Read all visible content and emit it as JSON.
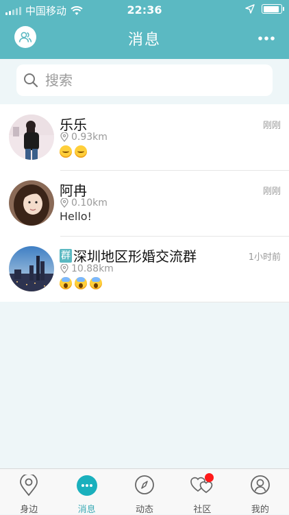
{
  "status_bar": {
    "carrier": "中国移动",
    "time": "22:36",
    "battery_level": 0.9
  },
  "header": {
    "title": "消息"
  },
  "search": {
    "placeholder": "搜索"
  },
  "conversations": [
    {
      "name": "乐乐",
      "is_group": false,
      "distance": "0.93km",
      "time": "刚刚",
      "message": "",
      "emojis": [
        "smile",
        "smile"
      ]
    },
    {
      "name": "阿冉",
      "is_group": false,
      "distance": "0.10km",
      "time": "刚刚",
      "message": "Hello!",
      "emojis": []
    },
    {
      "name": "深圳地区形婚交流群",
      "is_group": true,
      "group_badge": "群",
      "distance": "10.88km",
      "time": "1小时前",
      "message": "",
      "emojis": [
        "scream",
        "scream",
        "scream"
      ]
    }
  ],
  "tabbar": {
    "tabs": [
      {
        "label": "身边",
        "icon": "location-pin-icon"
      },
      {
        "label": "消息",
        "icon": "chat-bubble-icon",
        "active": true
      },
      {
        "label": "动态",
        "icon": "compass-icon"
      },
      {
        "label": "社区",
        "icon": "hearts-icon",
        "badge": true
      },
      {
        "label": "我的",
        "icon": "person-icon"
      }
    ]
  },
  "colors": {
    "primary": "#5bb9c2",
    "badge_red": "#ff1a1a"
  }
}
